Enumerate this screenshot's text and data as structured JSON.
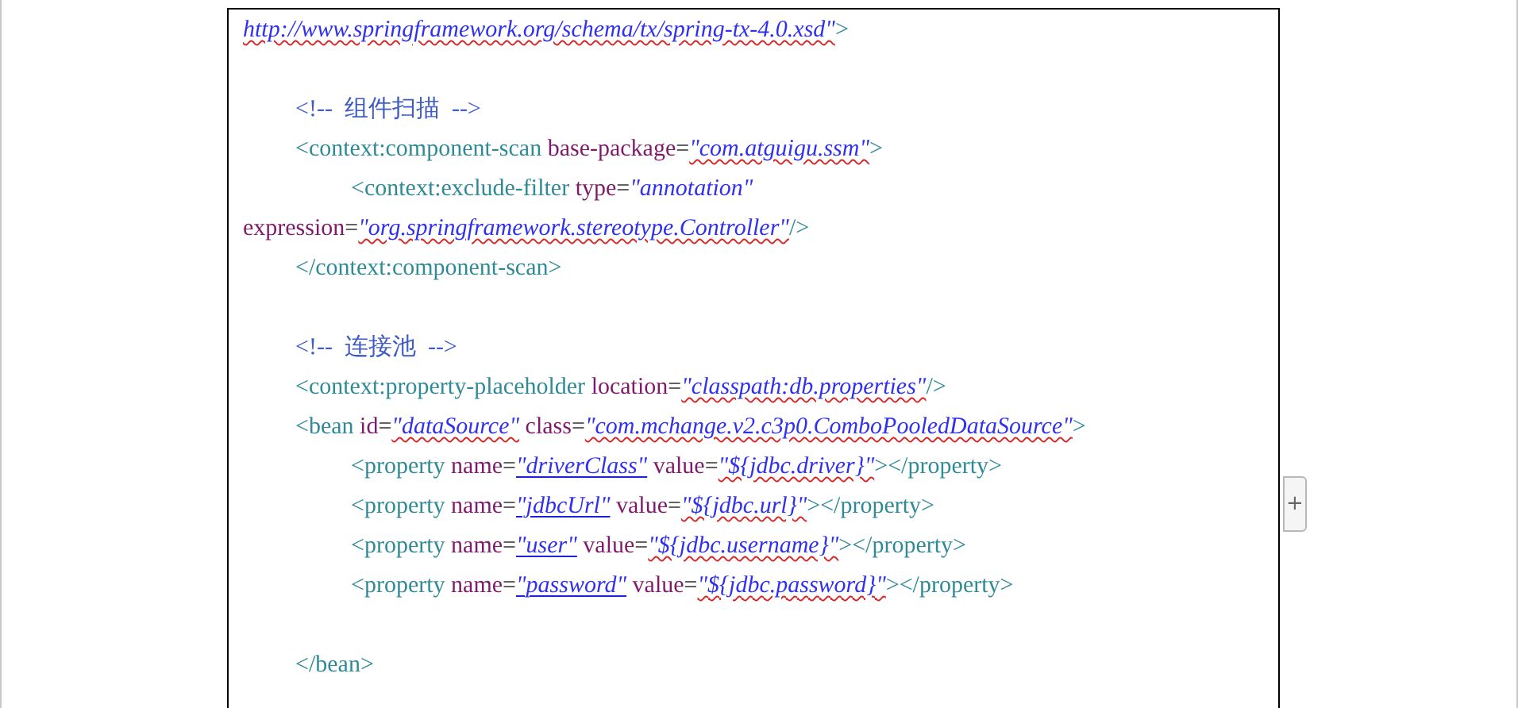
{
  "document": {
    "lines": [
      {
        "kind": "code",
        "segments": [
          {
            "kind": "value",
            "text": "http://www.springframework.org/schema/tx/spring-tx-4.0.xsd\"",
            "misspelled": true
          },
          {
            "kind": "tag",
            "text": ">"
          }
        ],
        "children": [
          {
            "kind": "blank"
          },
          {
            "kind": "code",
            "segments": [
              {
                "kind": "comment",
                "text": "<!--  组件扫描  -->"
              }
            ]
          },
          {
            "kind": "code",
            "segments": [
              {
                "kind": "tag",
                "text": "<context:component-scan "
              },
              {
                "kind": "attr",
                "text": "base-package"
              },
              {
                "kind": "punct",
                "text": "="
              },
              {
                "kind": "value",
                "text": "\"com.atguigu.ssm\"",
                "misspelled": true
              },
              {
                "kind": "tag",
                "text": ">"
              }
            ],
            "children": [
              {
                "kind": "code",
                "segments": [
                  {
                    "kind": "tag",
                    "text": "<context:exclude-filter "
                  },
                  {
                    "kind": "attr",
                    "text": "type"
                  },
                  {
                    "kind": "punct",
                    "text": "="
                  },
                  {
                    "kind": "value",
                    "text": "\"annotation\""
                  }
                ],
                "continuation": [
                  {
                    "kind": "attr",
                    "text": "expression"
                  },
                  {
                    "kind": "punct",
                    "text": "="
                  },
                  {
                    "kind": "value",
                    "text": "\"org.springframework.stereotype.Controller\"",
                    "misspelled": true
                  },
                  {
                    "kind": "tag",
                    "text": "/>"
                  }
                ]
              }
            ]
          },
          {
            "kind": "code",
            "segments": [
              {
                "kind": "tag",
                "text": "</context:component-scan>"
              }
            ]
          },
          {
            "kind": "blank"
          },
          {
            "kind": "code",
            "segments": [
              {
                "kind": "comment",
                "text": "<!--  连接池  -->"
              }
            ]
          },
          {
            "kind": "code",
            "segments": [
              {
                "kind": "tag",
                "text": "<context:property-placeholder "
              },
              {
                "kind": "attr",
                "text": "location"
              },
              {
                "kind": "punct",
                "text": "="
              },
              {
                "kind": "value",
                "text": "\"classpath:db.properties\"",
                "misspelled": true
              },
              {
                "kind": "tag",
                "text": "/>"
              }
            ]
          },
          {
            "kind": "code",
            "segments": [
              {
                "kind": "tag",
                "text": "<bean "
              },
              {
                "kind": "attr",
                "text": "id"
              },
              {
                "kind": "punct",
                "text": "="
              },
              {
                "kind": "value",
                "text": "\"dataSource\"",
                "misspelled": true
              },
              {
                "kind": "attr",
                "text": " class"
              },
              {
                "kind": "punct",
                "text": "="
              },
              {
                "kind": "value",
                "text": "\"com.mchange.v2.c3p0.ComboPooledDataSource\"",
                "misspelled": true
              },
              {
                "kind": "tag",
                "text": ">"
              }
            ],
            "children": [
              {
                "kind": "code",
                "segments": [
                  {
                    "kind": "tag",
                    "text": "<property "
                  },
                  {
                    "kind": "attr",
                    "text": "name"
                  },
                  {
                    "kind": "punct",
                    "text": "="
                  },
                  {
                    "kind": "value",
                    "text": "\"driverClass\"",
                    "linked": true
                  },
                  {
                    "kind": "attr",
                    "text": " value"
                  },
                  {
                    "kind": "punct",
                    "text": "="
                  },
                  {
                    "kind": "value",
                    "text": "\"${jdbc.driver}\"",
                    "misspelled": true
                  },
                  {
                    "kind": "tag",
                    "text": "></property>"
                  }
                ]
              },
              {
                "kind": "code",
                "segments": [
                  {
                    "kind": "tag",
                    "text": "<property "
                  },
                  {
                    "kind": "attr",
                    "text": "name"
                  },
                  {
                    "kind": "punct",
                    "text": "="
                  },
                  {
                    "kind": "value",
                    "text": "\"jdbcUrl\"",
                    "linked": true
                  },
                  {
                    "kind": "attr",
                    "text": " value"
                  },
                  {
                    "kind": "punct",
                    "text": "="
                  },
                  {
                    "kind": "value",
                    "text": "\"${jdbc.url}\"",
                    "misspelled": true
                  },
                  {
                    "kind": "tag",
                    "text": "></property>"
                  }
                ]
              },
              {
                "kind": "code",
                "segments": [
                  {
                    "kind": "tag",
                    "text": "<property "
                  },
                  {
                    "kind": "attr",
                    "text": "name"
                  },
                  {
                    "kind": "punct",
                    "text": "="
                  },
                  {
                    "kind": "value",
                    "text": "\"user\"",
                    "linked": true
                  },
                  {
                    "kind": "attr",
                    "text": " value"
                  },
                  {
                    "kind": "punct",
                    "text": "="
                  },
                  {
                    "kind": "value",
                    "text": "\"${jdbc.username}\"",
                    "misspelled": true
                  },
                  {
                    "kind": "tag",
                    "text": "></property>"
                  }
                ]
              },
              {
                "kind": "code",
                "segments": [
                  {
                    "kind": "tag",
                    "text": "<property "
                  },
                  {
                    "kind": "attr",
                    "text": "name"
                  },
                  {
                    "kind": "punct",
                    "text": "="
                  },
                  {
                    "kind": "value",
                    "text": "\"password\"",
                    "linked": true
                  },
                  {
                    "kind": "attr",
                    "text": " value"
                  },
                  {
                    "kind": "punct",
                    "text": "="
                  },
                  {
                    "kind": "value",
                    "text": "\"${jdbc.password}\"",
                    "misspelled": true
                  },
                  {
                    "kind": "tag",
                    "text": "></property>"
                  }
                ]
              },
              {
                "kind": "blank"
              }
            ]
          },
          {
            "kind": "code",
            "segments": [
              {
                "kind": "tag",
                "text": "</bean>"
              }
            ]
          }
        ]
      }
    ]
  },
  "add_button": {
    "label": "+"
  }
}
